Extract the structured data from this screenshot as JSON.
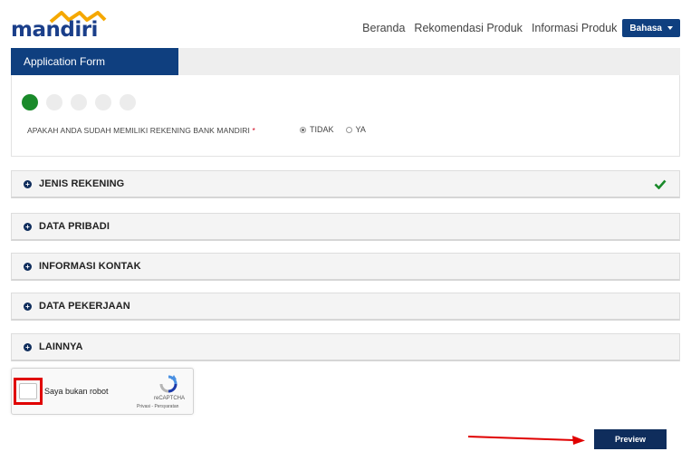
{
  "brand": {
    "name": "mandiri",
    "color": "#1b3f8a",
    "accent": "#f5a800"
  },
  "nav": {
    "items": [
      "Beranda",
      "Rekomendasi Produk",
      "Informasi Produk"
    ],
    "language_button": "Bahasa"
  },
  "form": {
    "tab_label": "Application Form",
    "steps": {
      "total": 5,
      "current": 1
    },
    "question": "APAKAH ANDA SUDAH MEMILIKI REKENING BANK MANDIRI",
    "required_mark": "*",
    "options": [
      {
        "label": "TIDAK",
        "selected": true
      },
      {
        "label": "YA",
        "selected": false
      }
    ]
  },
  "sections": [
    {
      "label": "JENIS REKENING",
      "completed": true
    },
    {
      "label": "DATA PRIBADI",
      "completed": false
    },
    {
      "label": "INFORMASI KONTAK",
      "completed": false
    },
    {
      "label": "DATA PEKERJAAN",
      "completed": false
    },
    {
      "label": "LAINNYA",
      "completed": false
    }
  ],
  "captcha": {
    "label": "Saya bukan robot",
    "brand": "reCAPTCHA",
    "links": "Privasi - Persyaratan"
  },
  "actions": {
    "preview_label": "Preview"
  },
  "colors": {
    "primary": "#0f3f7f",
    "success": "#1a8a2a",
    "highlight": "#e00000"
  }
}
